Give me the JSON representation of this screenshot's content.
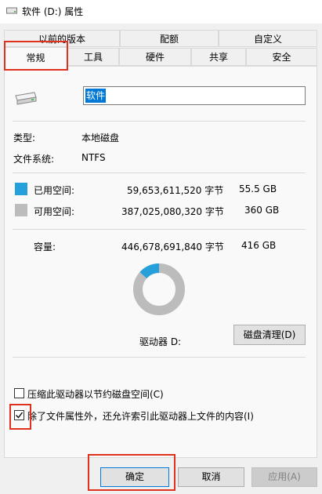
{
  "window": {
    "title": "软件 (D:) 属性"
  },
  "tabs_top": [
    "以前的版本",
    "配额",
    "自定义"
  ],
  "tabs_bottom": [
    "常规",
    "工具",
    "硬件",
    "共享",
    "安全"
  ],
  "general": {
    "name_value": "软件",
    "type_label": "类型:",
    "type_value": "本地磁盘",
    "fs_label": "文件系统:",
    "fs_value": "NTFS",
    "used_label": "已用空间:",
    "used_bytes": "59,653,611,520 字节",
    "used_size": "55.5 GB",
    "free_label": "可用空间:",
    "free_bytes": "387,025,080,320 字节",
    "free_size": "360 GB",
    "cap_label": "容量:",
    "cap_bytes": "446,678,691,840 字节",
    "cap_size": "416 GB",
    "drive_label": "驱动器 D:",
    "cleanup_btn": "磁盘清理(D)",
    "compress_label": "压缩此驱动器以节约磁盘空间(C)",
    "index_label": "除了文件属性外，还允许索引此驱动器上文件的内容(I)",
    "used_fraction": 0.134
  },
  "buttons": {
    "ok": "确定",
    "cancel": "取消",
    "apply": "应用(A)"
  },
  "colors": {
    "used": "#26a0da",
    "free": "#bcbcbc",
    "highlight": "#e0301e"
  }
}
